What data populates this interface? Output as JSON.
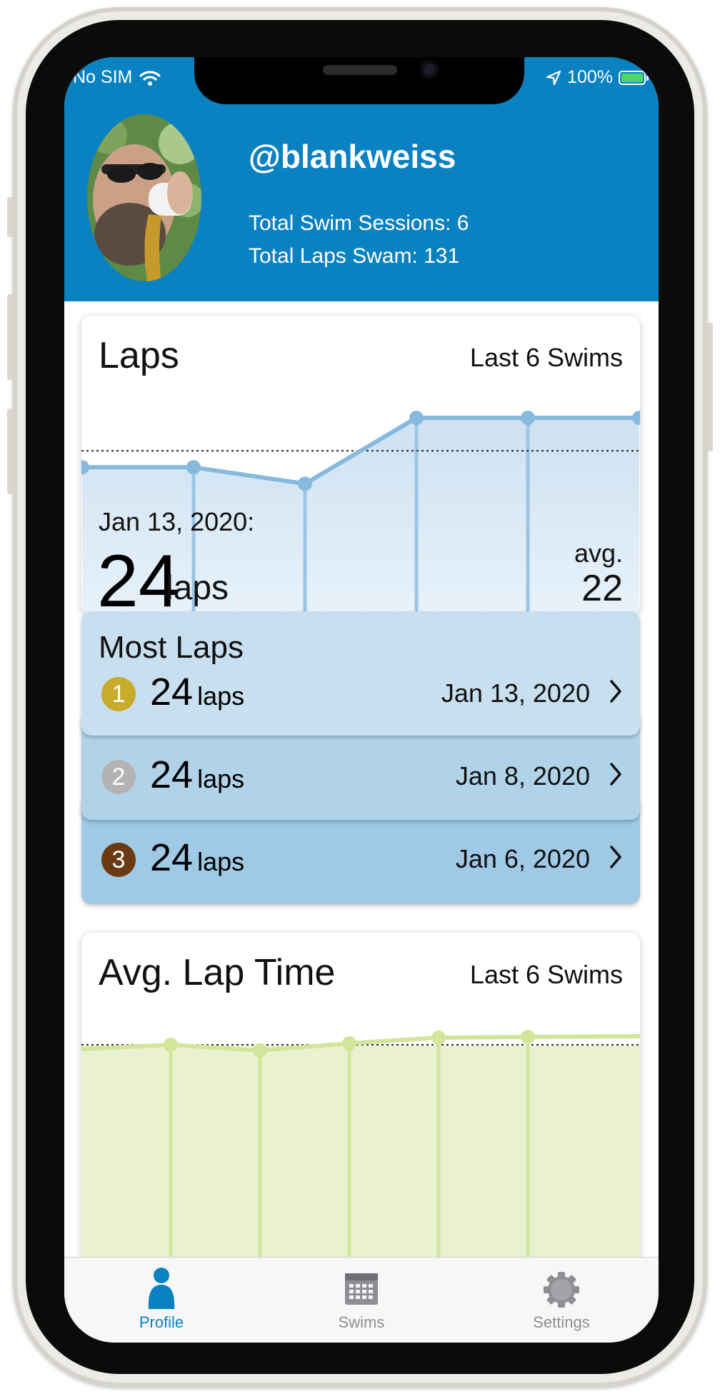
{
  "status_bar": {
    "carrier": "No SIM",
    "battery": "100%"
  },
  "profile": {
    "username": "@blankweiss",
    "total_sessions": "Total Swim Sessions: 6",
    "total_laps": "Total Laps Swam: 131"
  },
  "laps_card": {
    "title": "Laps",
    "range": "Last 6 Swims",
    "selected_date": "Jan 13, 2020:",
    "selected_value": "24",
    "selected_unit": "laps",
    "avg_label": "avg.",
    "avg_value": "22"
  },
  "most_laps": {
    "title": "Most Laps",
    "items": [
      {
        "rank": "1",
        "laps": "24",
        "unit": "laps",
        "date": "Jan 13, 2020",
        "medal_color": "#c9ab2b"
      },
      {
        "rank": "2",
        "laps": "24",
        "unit": "laps",
        "date": "Jan 8, 2020",
        "medal_color": "#b3b3b3"
      },
      {
        "rank": "3",
        "laps": "24",
        "unit": "laps",
        "date": "Jan 6, 2020",
        "medal_color": "#6b3a12"
      }
    ]
  },
  "lap_time_card": {
    "title": "Avg. Lap Time",
    "range": "Last 6 Swims"
  },
  "tabs": [
    {
      "label": "Profile",
      "icon": "person-icon",
      "active": true
    },
    {
      "label": "Swims",
      "icon": "calendar-icon",
      "active": false
    },
    {
      "label": "Settings",
      "icon": "gear-icon",
      "active": false
    }
  ],
  "colors": {
    "header": "#0a81c1",
    "accent": "#0a81c1",
    "laps_line": "#86b9de",
    "lap_time_line": "#d3e59a"
  },
  "chart_data": [
    {
      "type": "area",
      "title": "Laps",
      "values": [
        21,
        21,
        20,
        24,
        24,
        24
      ],
      "average": 22,
      "ylim": [
        12,
        25
      ]
    },
    {
      "type": "area",
      "title": "Avg. Lap Time",
      "values": [
        null,
        null,
        null,
        null,
        null,
        null
      ]
    }
  ]
}
